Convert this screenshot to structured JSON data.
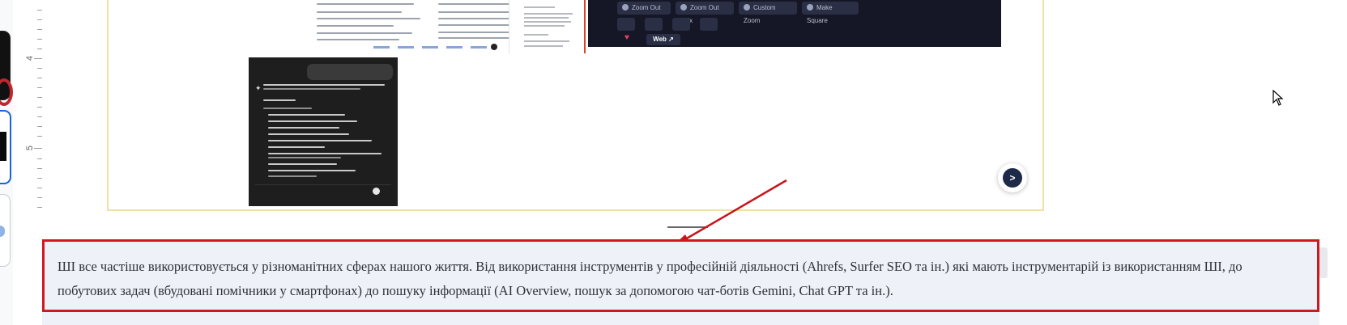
{
  "ruler": {
    "labels": [
      "4",
      "5"
    ]
  },
  "slide": {
    "dark_screenshot": {
      "buttons": [
        "Zoom Out 2x",
        "Zoom Out 1.5x",
        "Custom Zoom",
        "Make Square"
      ],
      "web_label": "Web"
    },
    "fab_icon": "chat-bot-icon"
  },
  "icons": {
    "cursor": "mouse-pointer-icon"
  },
  "textbox": {
    "text": "ШІ все частіше використовується у різноманітних сферах нашого життя. Від використання інструментів у професійній діяльності (Ahrefs, Surfer SEO та ін.) які мають інструментарій із використанням ШІ, до побутових задач (вбудовані помічники у смартфонах) до пошуку інформації (AI Overview, пошук за допомогою чат-ботів Gemini, Chat GPT та ін.)."
  },
  "colors": {
    "highlight_border": "#d0191f",
    "arrow": "#c8151b",
    "slide_border": "#f0e0a6"
  }
}
